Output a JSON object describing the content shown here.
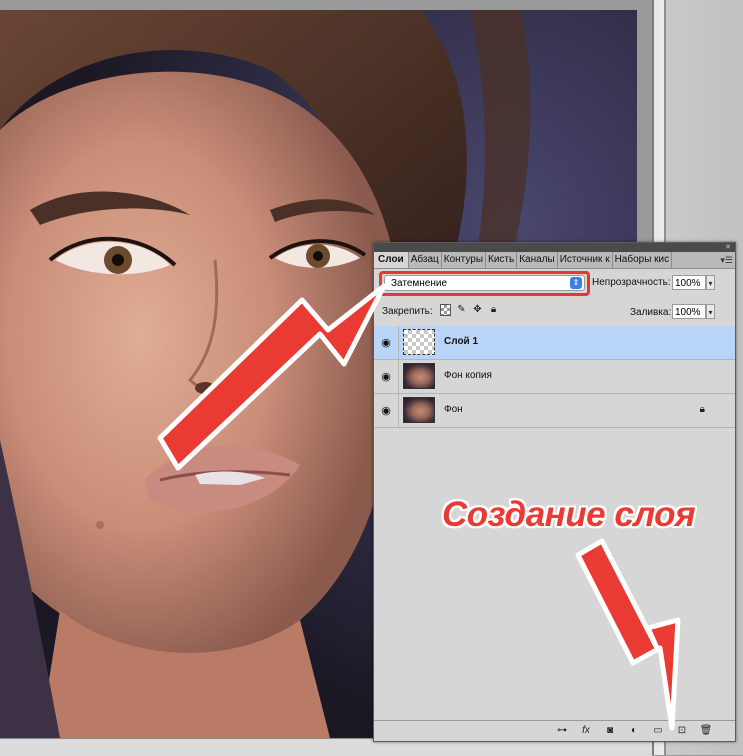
{
  "panel": {
    "tabs": [
      "Слои",
      "Абзац",
      "Контуры",
      "Кисть",
      "Каналы",
      "Источник к",
      "Наборы кис"
    ],
    "menu_icon": "panel-menu-icon",
    "blend_mode": "Затемнение",
    "opacity_label": "Непрозрачность:",
    "opacity_value": "100%",
    "lock_label": "Закрепить:",
    "fill_label": "Заливка:",
    "fill_value": "100%",
    "layers": [
      {
        "name": "Слой 1",
        "selected": true,
        "thumb": "transparent",
        "locked": false
      },
      {
        "name": "Фон копия",
        "selected": false,
        "thumb": "photo",
        "locked": false
      },
      {
        "name": "Фон",
        "selected": false,
        "thumb": "photo",
        "locked": true
      }
    ],
    "footer_icons": [
      "link-icon",
      "fx-icon",
      "mask-icon",
      "adjustment-icon",
      "folder-icon",
      "new-layer-icon",
      "trash-icon"
    ]
  },
  "annotation": {
    "caption": "Создание слоя",
    "color": "#e93a33"
  }
}
